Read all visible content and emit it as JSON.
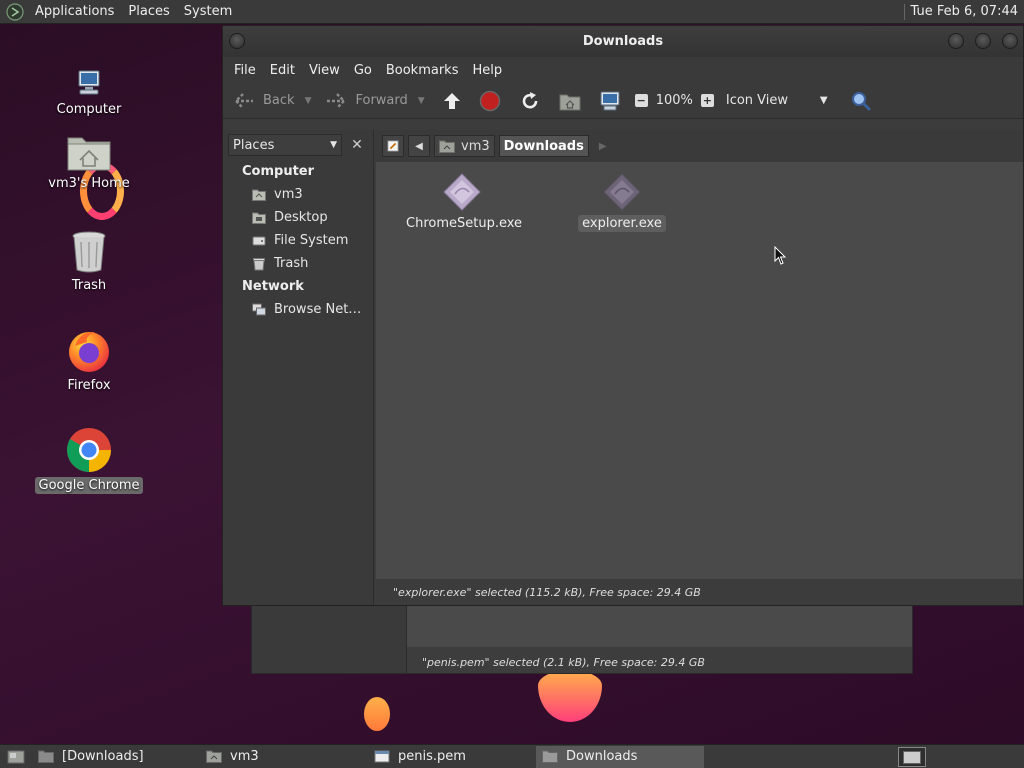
{
  "top_panel": {
    "menus": [
      "Applications",
      "Places",
      "System"
    ],
    "clock": "Tue Feb  6, 07:44"
  },
  "desktop": {
    "icons": [
      {
        "label": "Computer",
        "icon": "computer-icon"
      },
      {
        "label": "vm3's Home",
        "icon": "home-folder-icon"
      },
      {
        "label": "Trash",
        "icon": "trash-icon"
      },
      {
        "label": "Firefox",
        "icon": "firefox-icon"
      },
      {
        "label": "Google Chrome",
        "icon": "chrome-icon",
        "selected": true
      }
    ]
  },
  "back_window": {
    "status": "\"penis.pem\" selected (2.1 kB), Free space: 29.4 GB"
  },
  "window": {
    "title": "Downloads",
    "menu": [
      "File",
      "Edit",
      "View",
      "Go",
      "Bookmarks",
      "Help"
    ],
    "toolbar": {
      "back_label": "Back",
      "forward_label": "Forward",
      "zoom": "100%",
      "view_mode": "Icon View"
    },
    "sidebar": {
      "header": "Places",
      "sections": [
        {
          "title": "Computer",
          "items": [
            "vm3",
            "Desktop",
            "File System",
            "Trash"
          ]
        },
        {
          "title": "Network",
          "items": [
            "Browse Net…"
          ]
        }
      ]
    },
    "pathbar": {
      "crumbs": [
        "vm3",
        "Downloads"
      ],
      "active": "Downloads"
    },
    "files": [
      {
        "name": "ChromeSetup.exe",
        "icon": "exe-file-icon",
        "selected": false
      },
      {
        "name": "explorer.exe",
        "icon": "exe-file-icon",
        "selected": true
      }
    ],
    "status": "\"explorer.exe\" selected (115.2 kB), Free space: 29.4 GB"
  },
  "taskbar": {
    "tasks": [
      {
        "label": "[Downloads]",
        "icon": "folder-icon",
        "active": false
      },
      {
        "label": "vm3",
        "icon": "home-folder-icon",
        "active": false
      },
      {
        "label": "penis.pem",
        "icon": "text-file-icon",
        "active": false
      },
      {
        "label": "Downloads",
        "icon": "folder-icon",
        "active": true
      }
    ]
  },
  "colors": {
    "desktop_bg": "#3b1233",
    "panel_bg": "#3a3a3a",
    "window_bg": "#3c3c3c",
    "iconview_bg": "#4a4a4a",
    "selection": "#5e5e5e"
  }
}
